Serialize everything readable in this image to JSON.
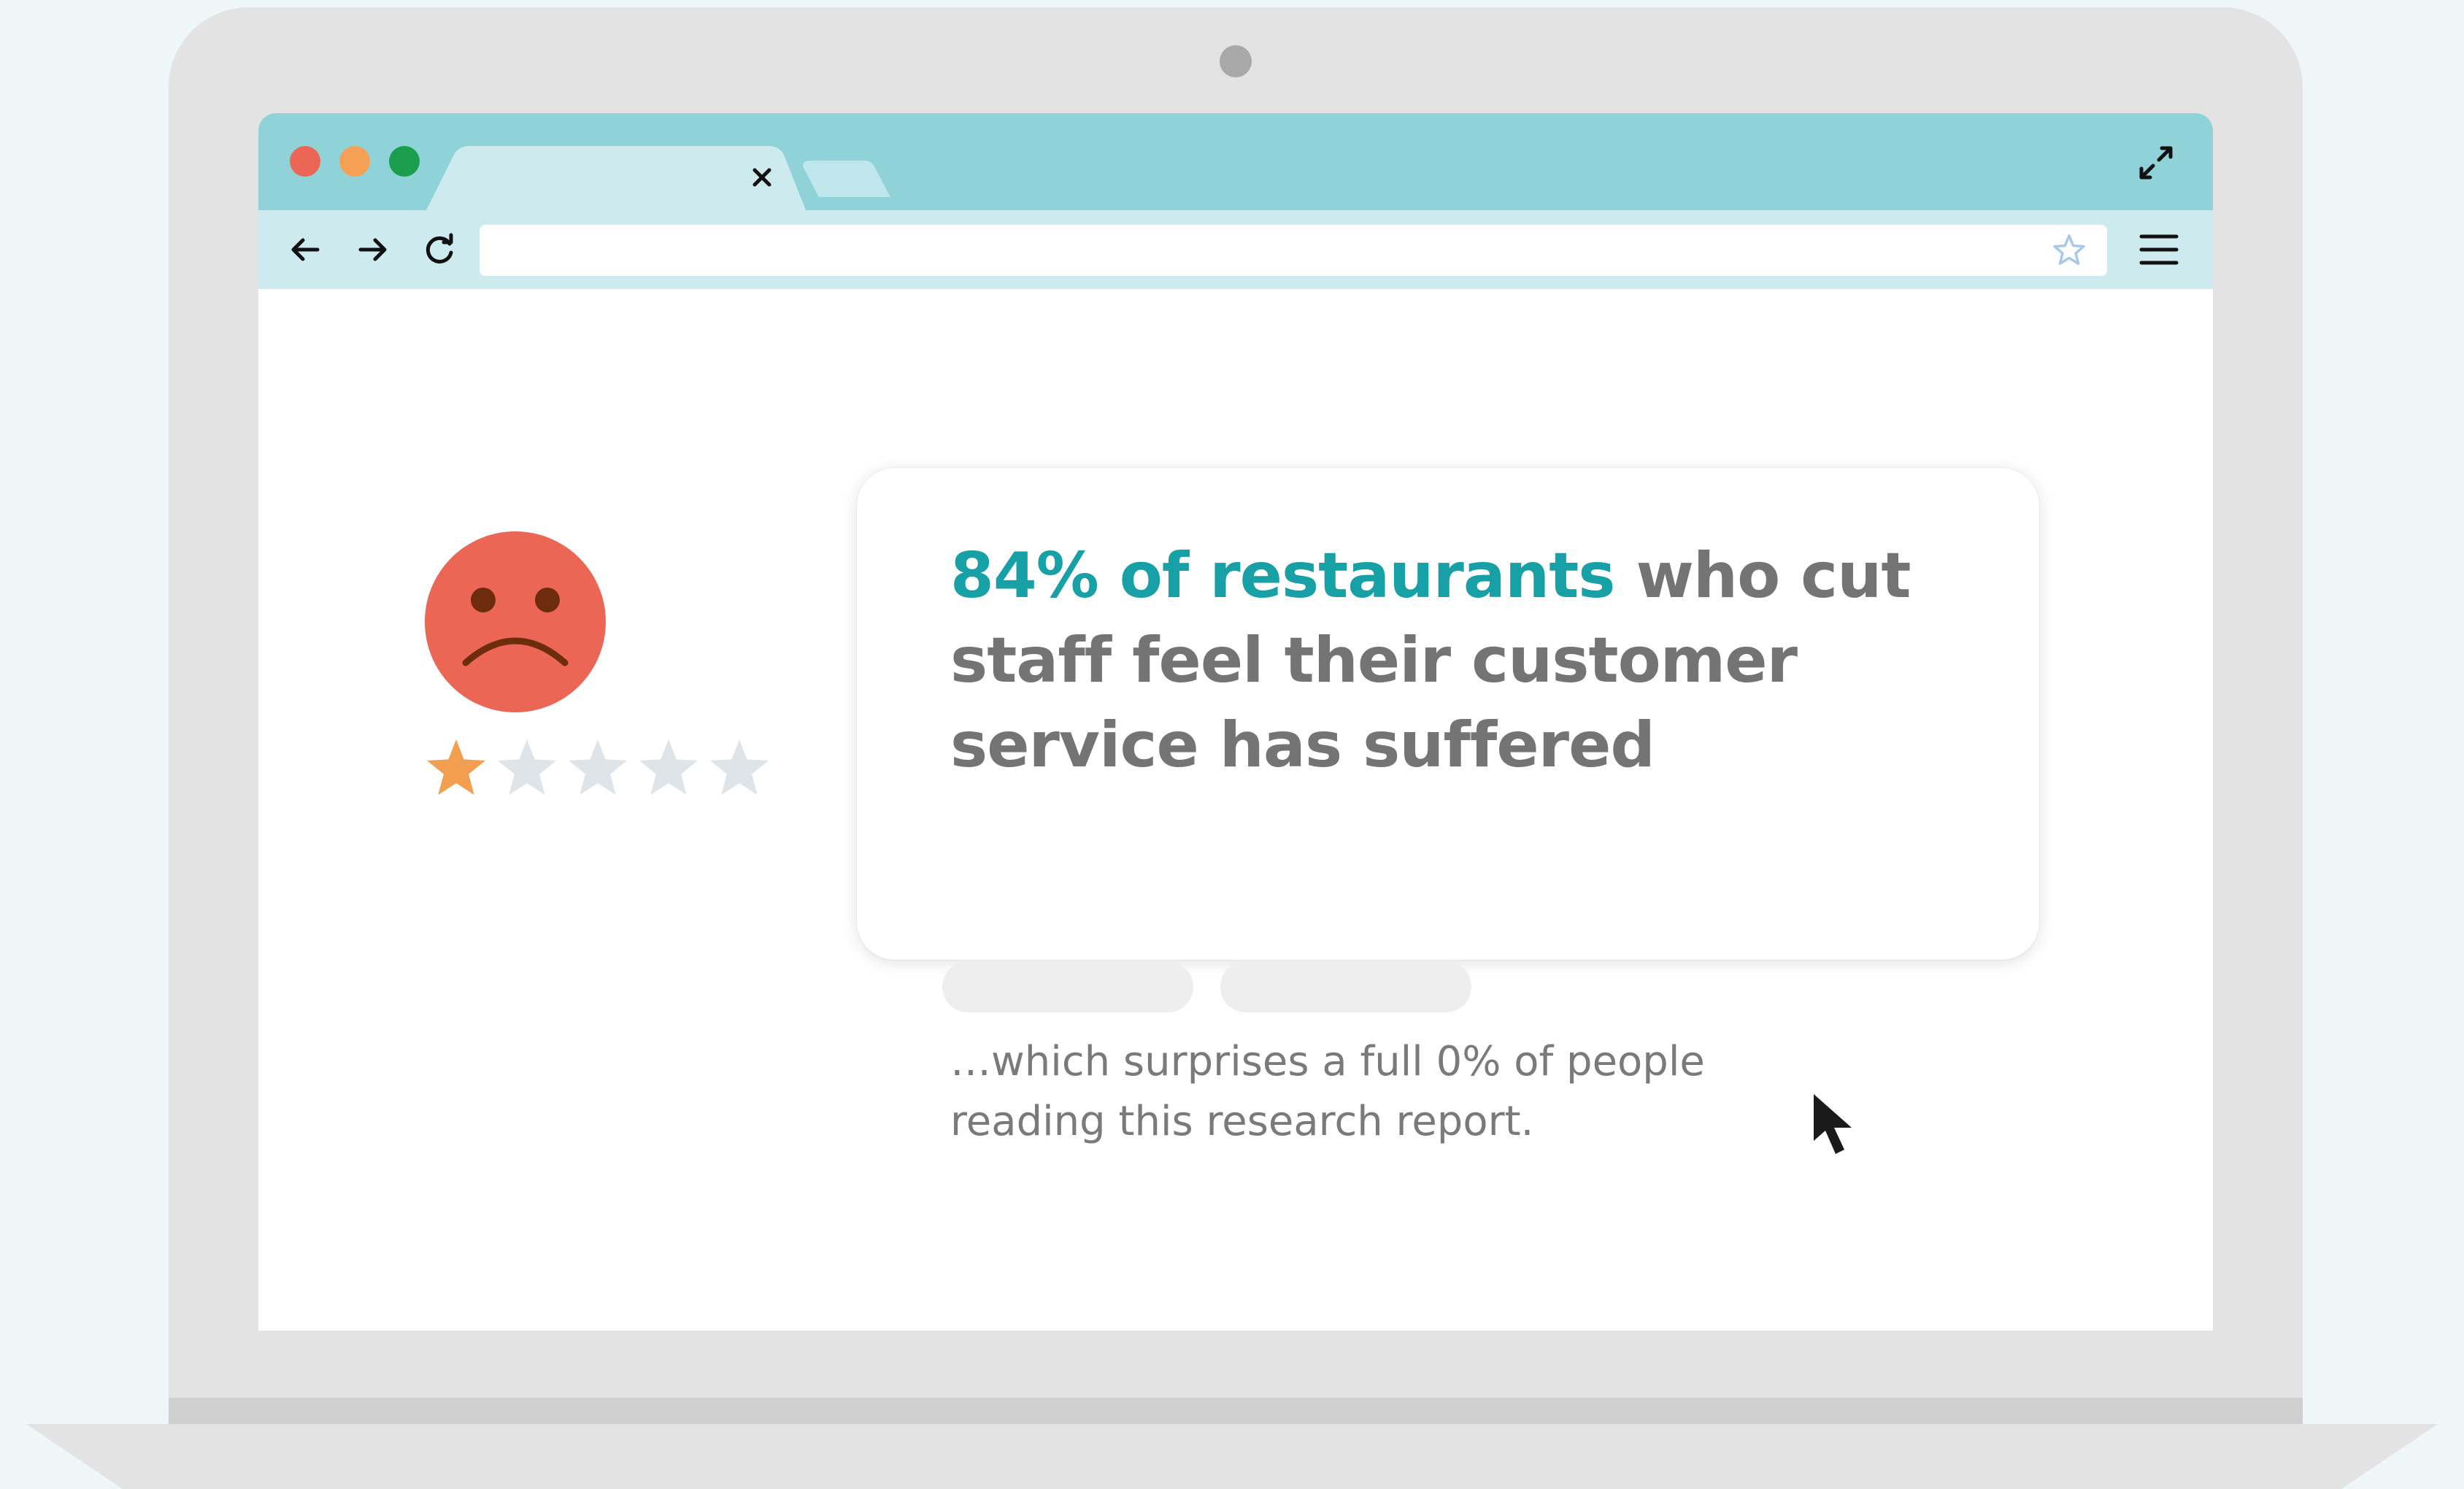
{
  "browser": {
    "tab": {
      "close_icon": "close-icon"
    },
    "window_controls": {
      "close_color": "#ec6656",
      "minimize_color": "#f5a155",
      "maximize_color": "#1c9e4f"
    },
    "toolbar": {
      "address_value": "",
      "icons": [
        "back-arrow-icon",
        "forward-arrow-icon",
        "reload-icon",
        "bookmark-star-icon",
        "hamburger-menu-icon",
        "expand-icon"
      ]
    }
  },
  "content": {
    "headline_accent": "84% of restaurants",
    "headline_rest": " who cut staff feel their customer service has suffered",
    "subtext": "…which surprises a full 0% of people reading this research report.",
    "rating": {
      "value": 1,
      "max": 5,
      "filled_color": "#f29f51",
      "empty_color": "#dfe4e8"
    },
    "face_color": "#ec6656",
    "accent_color": "#17a0a6"
  }
}
